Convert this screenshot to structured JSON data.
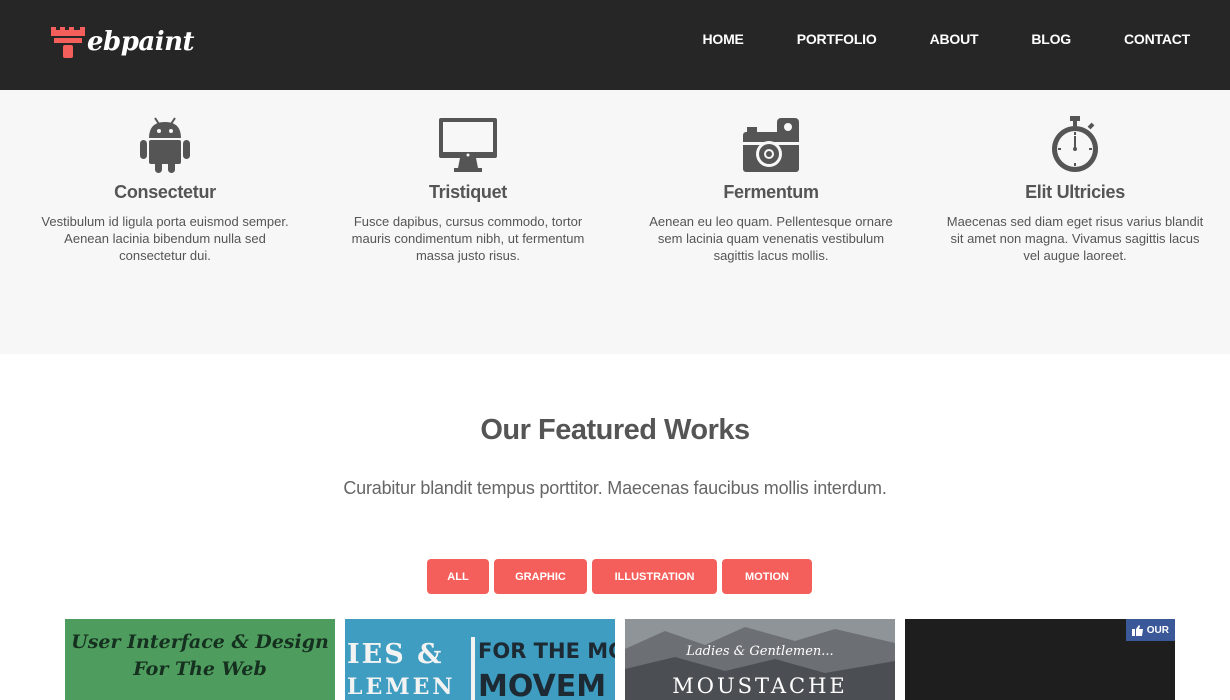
{
  "brand": {
    "logo_text": "ebpaint",
    "logo_color": "#f55f5b"
  },
  "nav": {
    "items": [
      {
        "label": "HOME"
      },
      {
        "label": "PORTFOLIO"
      },
      {
        "label": "ABOUT"
      },
      {
        "label": "BLOG"
      },
      {
        "label": "CONTACT"
      }
    ]
  },
  "features": [
    {
      "icon": "android-icon",
      "title": "Consectetur",
      "text": "Vestibulum id ligula porta euismod semper. Aenean lacinia bibendum nulla sed consectetur dui."
    },
    {
      "icon": "monitor-icon",
      "title": "Tristiquet",
      "text": "Fusce dapibus, cursus commodo, tortor mauris condimentum nibh, ut fermentum massa justo risus."
    },
    {
      "icon": "camera-icon",
      "title": "Fermentum",
      "text": "Aenean eu leo quam. Pellentesque ornare sem lacinia quam venenatis vestibulum sagittis lacus mollis."
    },
    {
      "icon": "stopwatch-icon",
      "title": "Elit Ultricies",
      "text": "Maecenas sed diam eget risus varius blandit sit amet non magna. Vivamus sagittis lacus vel augue laoreet."
    }
  ],
  "works": {
    "title": "Our Featured Works",
    "subtitle": "Curabitur blandit tempus porttitor. Maecenas faucibus mollis interdum.",
    "filters": [
      "ALL",
      "GRAPHIC",
      "ILLUSTRATION",
      "MOTION"
    ],
    "accent": "#f55f5b"
  },
  "tiles": {
    "t1": {
      "line1": "User Interface & Design",
      "line2": "For The Web"
    },
    "t2": {
      "left1": "IES &",
      "left2": "LEMEN",
      "right1": "FOR THE MO",
      "right2": "MOVEM"
    },
    "t3": {
      "small": "Ladies & Gentlemen...",
      "big": "MOUSTACHE"
    },
    "t4": {
      "badge": "OUR"
    }
  }
}
